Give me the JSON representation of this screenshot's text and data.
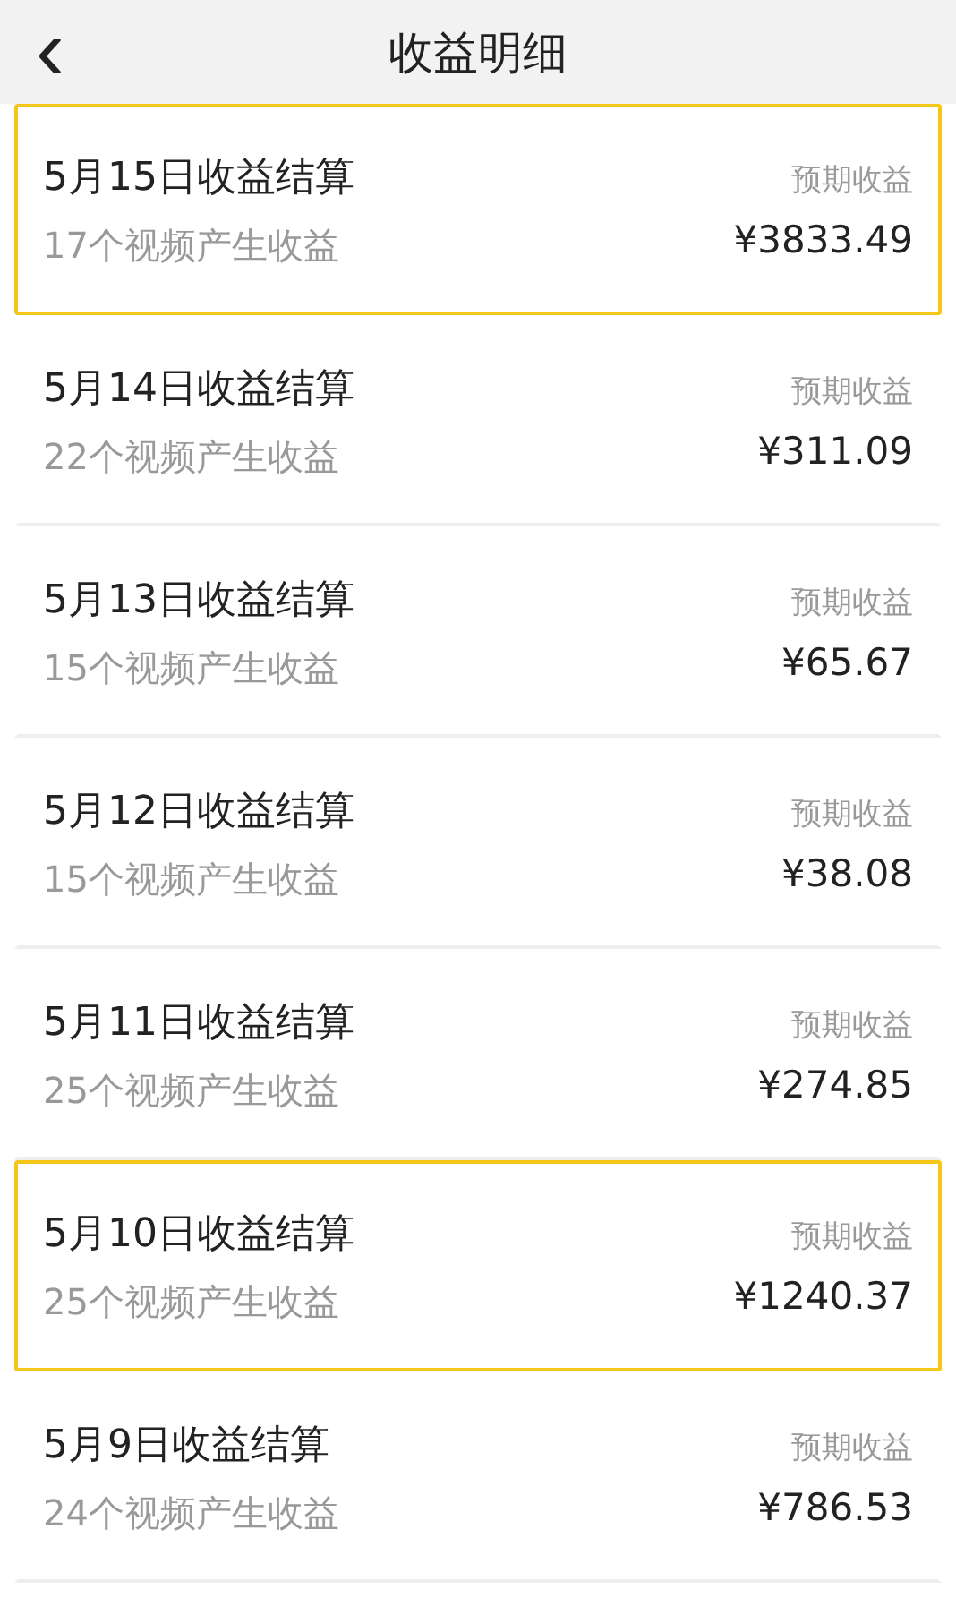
{
  "header": {
    "back": "‹",
    "title": "收益明细"
  },
  "rows": [
    {
      "title": "5月15日收益结算",
      "subtitle": "17个视频产生收益",
      "label": "预期收益",
      "amount": "¥3833.49",
      "highlighted": true
    },
    {
      "title": "5月14日收益结算",
      "subtitle": "22个视频产生收益",
      "label": "预期收益",
      "amount": "¥311.09",
      "highlighted": false
    },
    {
      "title": "5月13日收益结算",
      "subtitle": "15个视频产生收益",
      "label": "预期收益",
      "amount": "¥65.67",
      "highlighted": false
    },
    {
      "title": "5月12日收益结算",
      "subtitle": "15个视频产生收益",
      "label": "预期收益",
      "amount": "¥38.08",
      "highlighted": false
    },
    {
      "title": "5月11日收益结算",
      "subtitle": "25个视频产生收益",
      "label": "预期收益",
      "amount": "¥274.85",
      "highlighted": false
    },
    {
      "title": "5月10日收益结算",
      "subtitle": "25个视频产生收益",
      "label": "预期收益",
      "amount": "¥1240.37",
      "highlighted": true
    },
    {
      "title": "5月9日收益结算",
      "subtitle": "24个视频产生收益",
      "label": "预期收益",
      "amount": "¥786.53",
      "highlighted": false
    }
  ]
}
